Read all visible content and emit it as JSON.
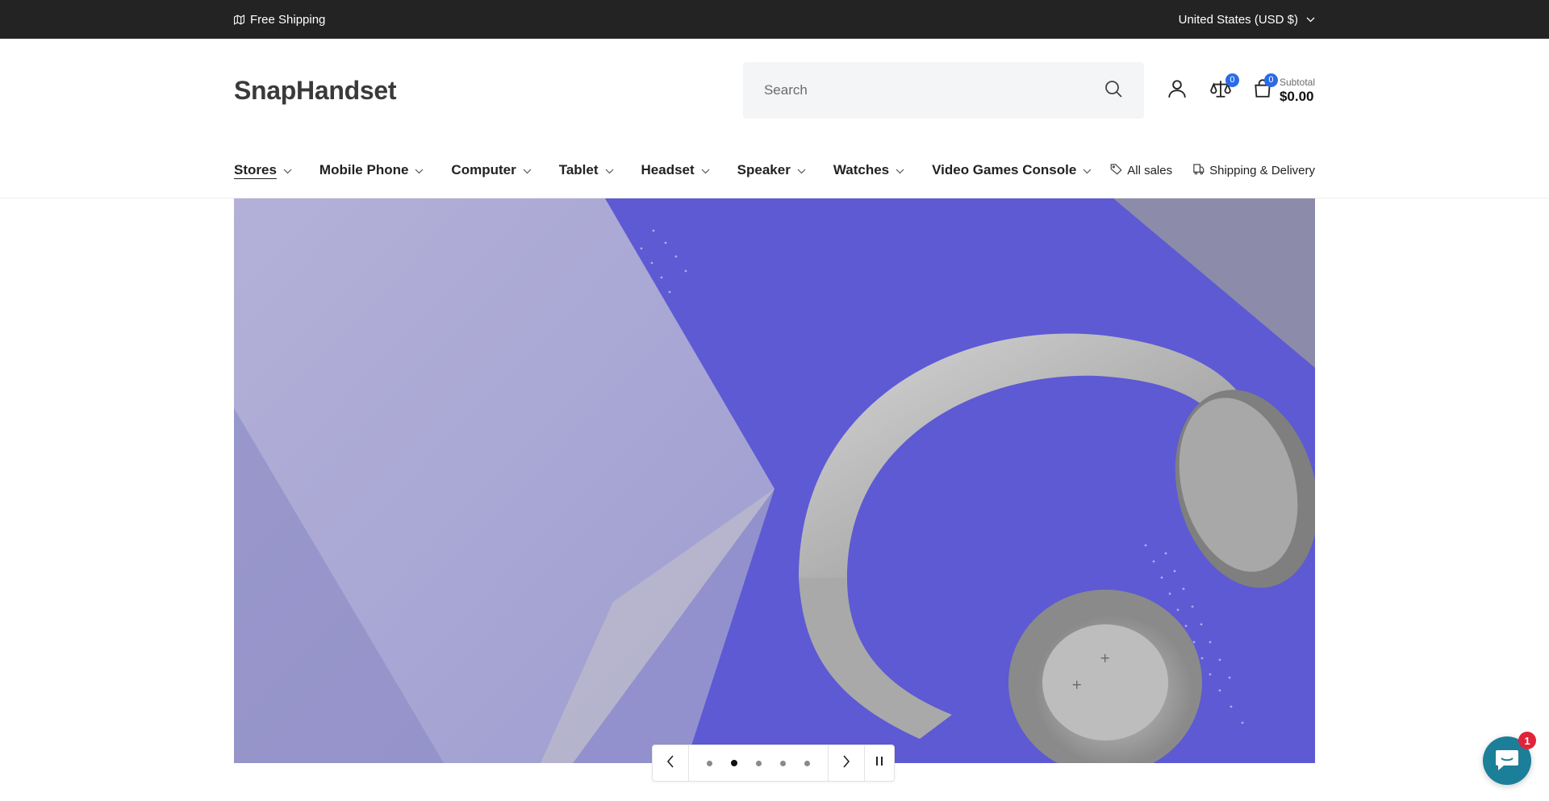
{
  "announcement": {
    "left_text": "Free Shipping",
    "left_icon": "map-icon",
    "country_selector": "United States (USD $)"
  },
  "header": {
    "logo": "SnapHandset",
    "search": {
      "placeholder": "Search",
      "value": ""
    },
    "compare_count": "0",
    "cart": {
      "count": "0",
      "subtotal_label": "Subtotal",
      "subtotal_value": "$0.00"
    }
  },
  "nav": {
    "items": [
      {
        "label": "Stores",
        "active": true
      },
      {
        "label": "Mobile Phone"
      },
      {
        "label": "Computer"
      },
      {
        "label": "Tablet"
      },
      {
        "label": "Headset"
      },
      {
        "label": "Speaker"
      },
      {
        "label": "Watches"
      },
      {
        "label": "Video Games Console"
      }
    ],
    "links": [
      {
        "label": "All sales",
        "icon": "tag-icon"
      },
      {
        "label": "Shipping & Delivery",
        "icon": "box-icon"
      }
    ]
  },
  "hero": {
    "slide_count": 5,
    "active_slide": 2,
    "image": "headphones-on-purple-background",
    "colors": {
      "background": "#5d5ad3",
      "panel": "#a7a6cf"
    }
  },
  "chat": {
    "unread": "1"
  },
  "colors": {
    "announcement_bg": "#232323",
    "badge": "#2b6be6",
    "chat": "#1b7f99",
    "chat_badge": "#e0243a"
  }
}
